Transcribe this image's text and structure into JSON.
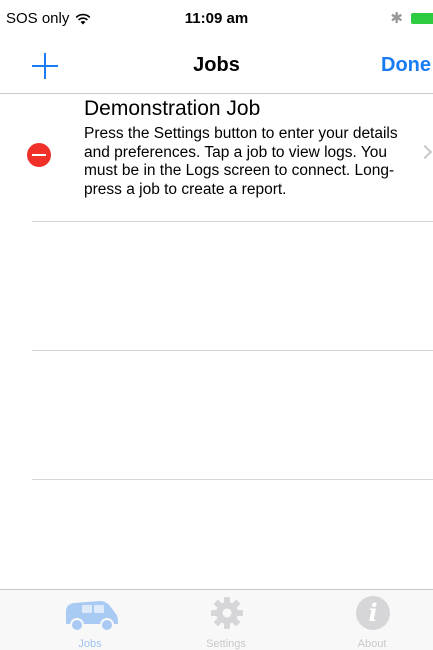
{
  "status_bar": {
    "carrier": "SOS only",
    "time": "11:09 am"
  },
  "nav": {
    "title": "Jobs",
    "done_label": "Done",
    "add_icon": "plus-icon"
  },
  "jobs": [
    {
      "title": "Demonstration Job",
      "description": "Press the Settings button to enter your details and preferences. Tap a job to view logs. You must be in the Logs screen to connect. Long-press a job to create a report."
    }
  ],
  "tabs": [
    {
      "label": "Jobs",
      "icon": "van-icon",
      "selected": true
    },
    {
      "label": "Settings",
      "icon": "gear-icon",
      "selected": false
    },
    {
      "label": "About",
      "icon": "info-icon",
      "selected": false
    }
  ],
  "colors": {
    "accent": "#1a7cf5",
    "delete": "#f2302a",
    "battery": "#2ecc40"
  }
}
